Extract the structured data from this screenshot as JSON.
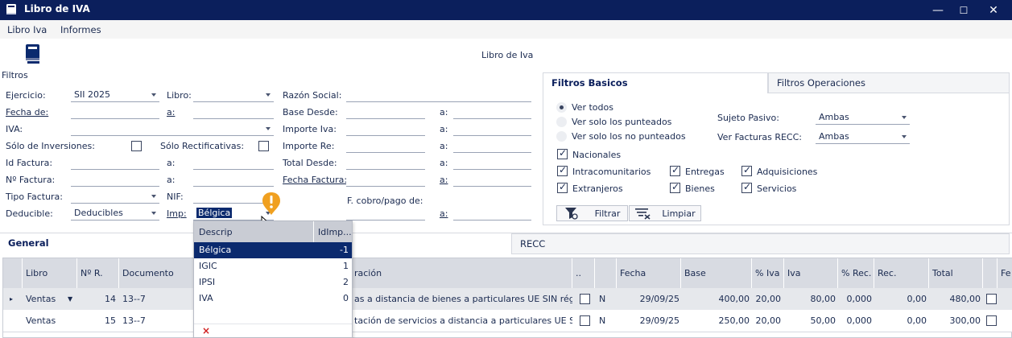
{
  "window": {
    "title": "Libro de IVA",
    "controls": [
      "—",
      "☐",
      "✕"
    ]
  },
  "menu": [
    "Libro Iva",
    "Informes"
  ],
  "header": {
    "center_title": "Libro de Iva",
    "filtros_label": "Filtros"
  },
  "filters": {
    "ejercicio_label": "Ejercicio:",
    "ejercicio_value": "SII 2025",
    "libro_label": "Libro:",
    "razon_social_label": "Razón Social:",
    "fecha_de_label": "Fecha de:",
    "a_label": "a:",
    "base_desde_label": "Base Desde:",
    "iva_label": "IVA:",
    "importe_iva_label": "Importe Iva:",
    "solo_inversiones_label": "Sólo de Inversiones:",
    "solo_rectificativas_label": "Sólo Rectificativas:",
    "importe_re_label": "Importe Re:",
    "id_factura_label": "Id Factura:",
    "total_desde_label": "Total Desde:",
    "n_factura_label": "Nº Factura:",
    "fecha_factura_label": "Fecha Factura:",
    "tipo_factura_label": "Tipo Factura:",
    "nif_label": "NIF:",
    "f_cobro_label": "F. cobro/pago de:",
    "deducible_label": "Deducible:",
    "deducible_value": "Deducibles",
    "imp_label": "Imp:",
    "imp_value": "Bélgica"
  },
  "filter_tabs": {
    "basicos": "Filtros Basicos",
    "operaciones": "Filtros Operaciones"
  },
  "basicos": {
    "radio_ver_todos": "Ver todos",
    "radio_punteados": "Ver solo los punteados",
    "radio_no_punteados": "Ver solo los no punteados",
    "sujeto_pasivo_label": "Sujeto Pasivo:",
    "sujeto_pasivo_value": "Ambas",
    "ver_facturas_recc_label": "Ver Facturas RECC:",
    "ver_facturas_recc_value": "Ambas",
    "nacionales": "Nacionales",
    "intracomunitarios": "Intracomunitarios",
    "entregas": "Entregas",
    "adquisiciones": "Adquisiciones",
    "extranjeros": "Extranjeros",
    "bienes": "Bienes",
    "servicios": "Servicios",
    "filtrar_button": "Filtrar",
    "limpiar_button": "Limpiar"
  },
  "main_tabs": {
    "general": "General",
    "recc": "RECC"
  },
  "grid": {
    "columns": [
      "Libro",
      "Nº R.",
      "Documento",
      "ración",
      "..",
      "Fecha",
      "Base",
      "% Iva",
      "Iva",
      "% Rec.",
      "Rec.",
      "Total",
      "Fe"
    ],
    "rows": [
      {
        "libro": "Ventas",
        "nr": "14",
        "documento": "13--7",
        "descripcion": "as a distancia de bienes a particulares UE SIN régi...",
        "flag": "N",
        "fecha": "29/09/25",
        "base": "400,00",
        "piva": "20,00",
        "iva": "80,00",
        "prec": "0,000",
        "rec": "0,00",
        "total": "480,00"
      },
      {
        "libro": "Ventas",
        "nr": "15",
        "documento": "13--7",
        "descripcion": "tación de servicios a distancia a particulares UE SI...",
        "flag": "N",
        "fecha": "29/09/25",
        "base": "250,00",
        "piva": "20,00",
        "iva": "50,00",
        "prec": "0,000",
        "rec": "0,00",
        "total": "300,00"
      }
    ]
  },
  "dropdown": {
    "col_descrip": "Descrip",
    "col_id": "IdImp...",
    "items": [
      {
        "descrip": "Bélgica",
        "id": "-1"
      },
      {
        "descrip": "IGIC",
        "id": "1"
      },
      {
        "descrip": "IPSI",
        "id": "2"
      },
      {
        "descrip": "IVA",
        "id": "0"
      }
    ],
    "clear_glyph": "×"
  },
  "colors": {
    "titlebar": "#0b1f5c",
    "selection": "#0b2a6e",
    "warning": "#f0a020"
  }
}
